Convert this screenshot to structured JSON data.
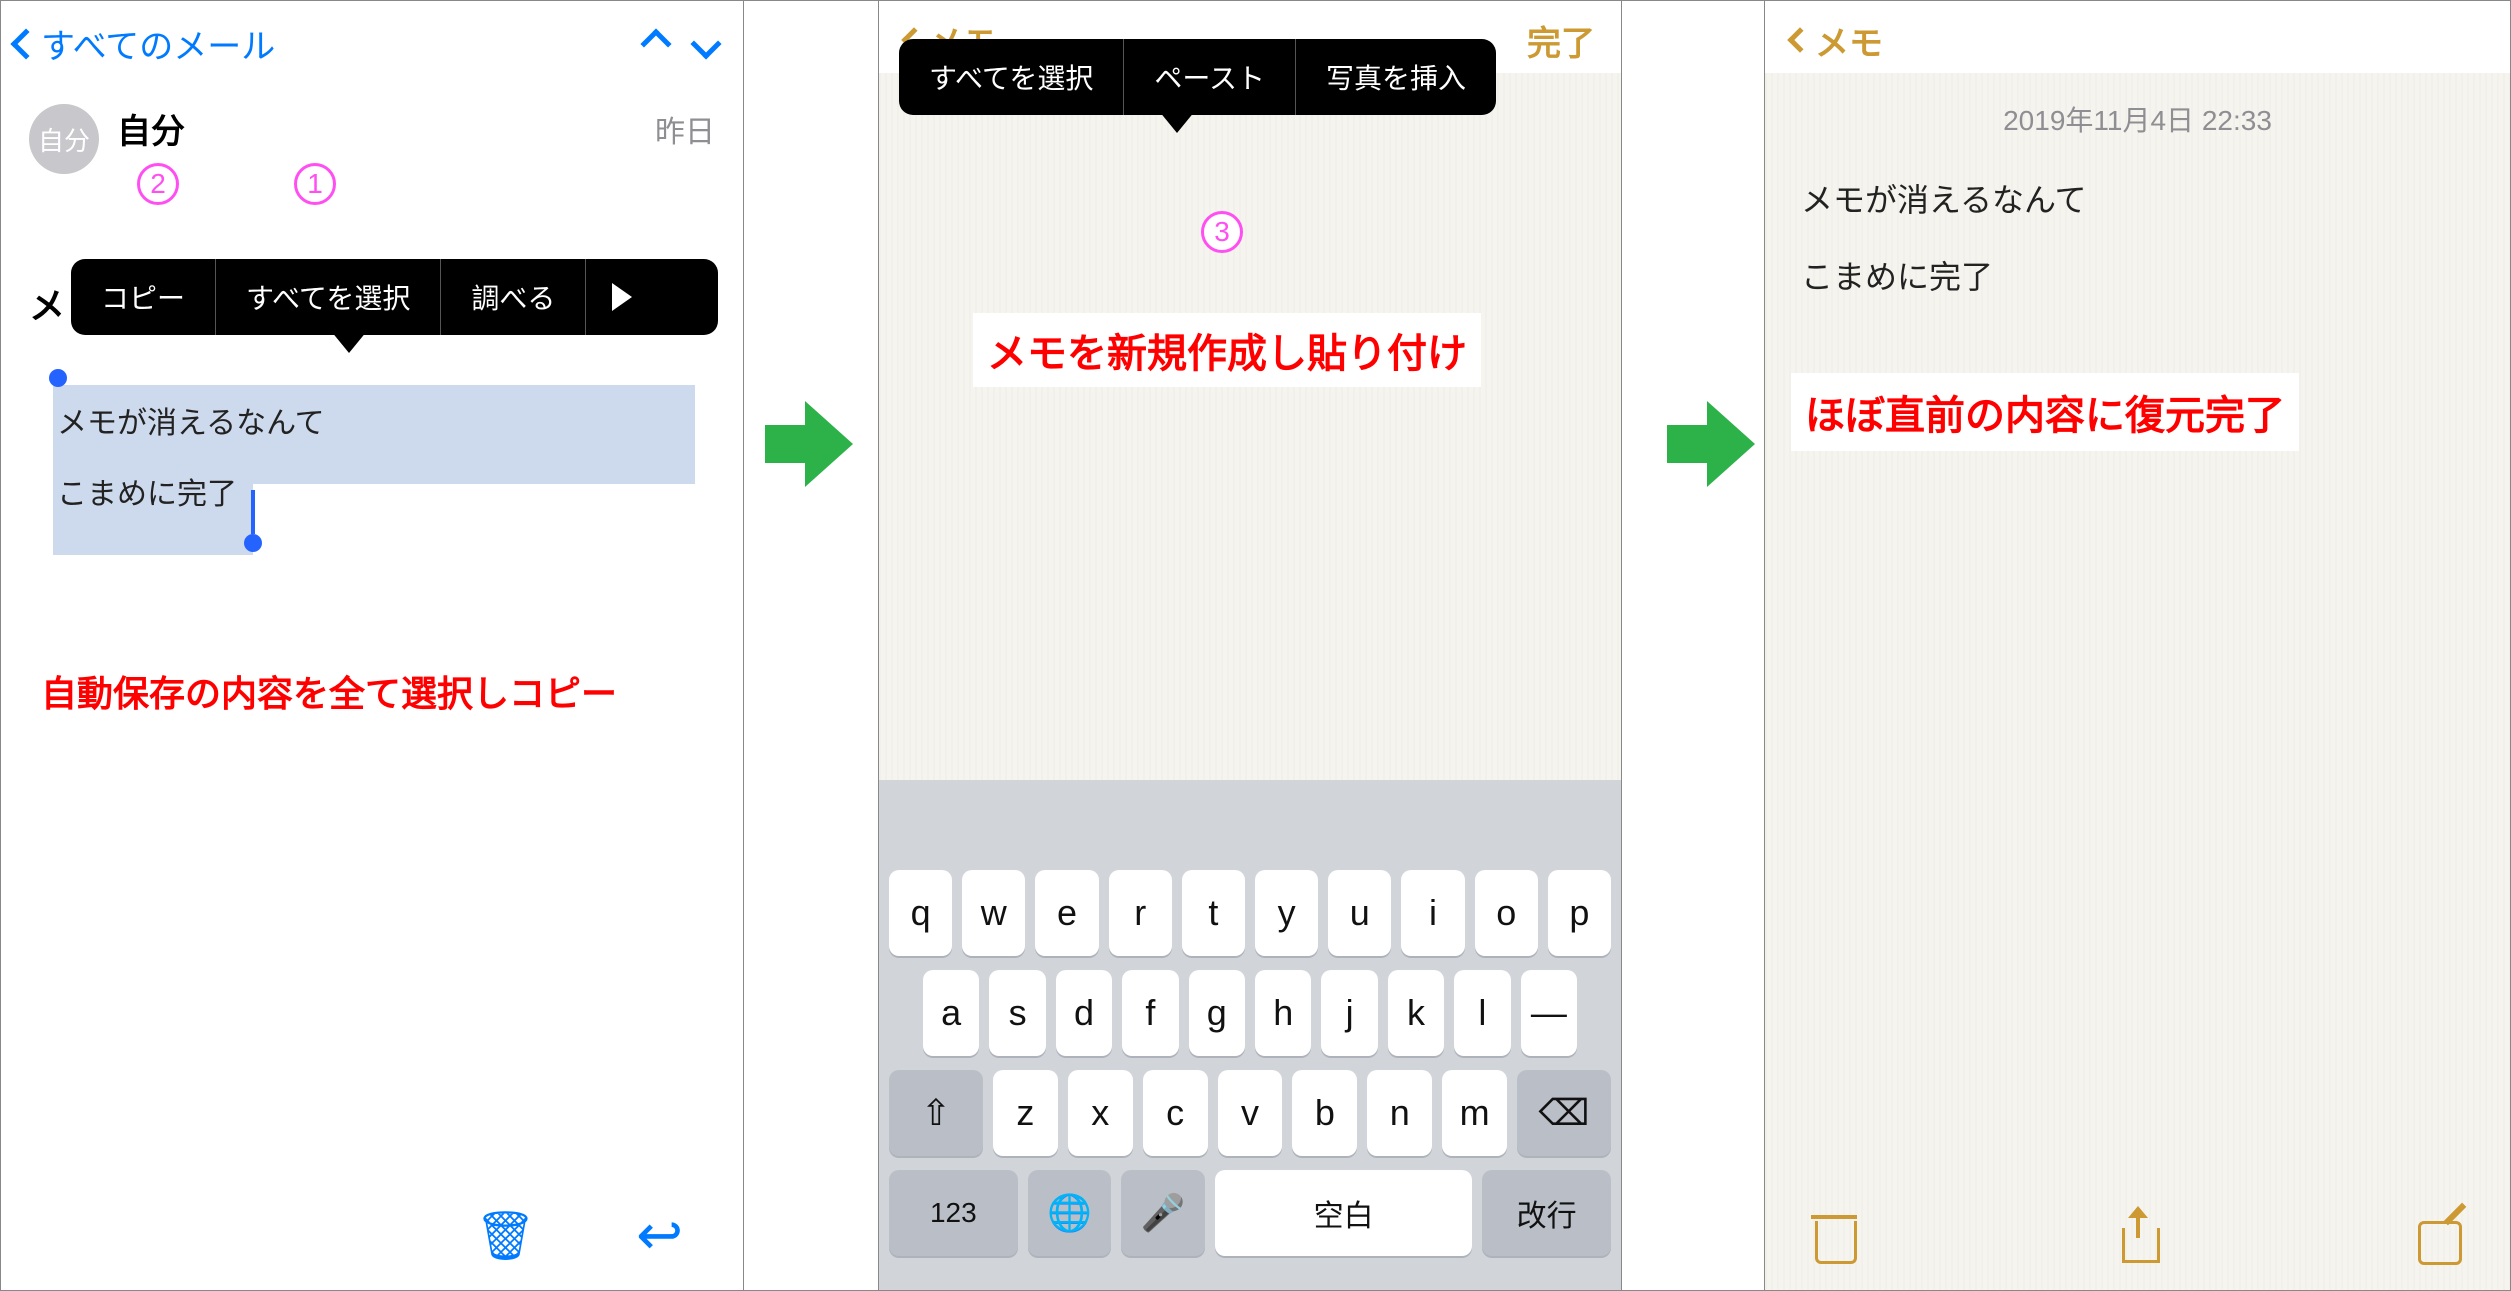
{
  "screen1": {
    "back_label": "すべてのメール",
    "avatar_text": "自分",
    "sender_name": "自分",
    "sender_date": "昨日",
    "circled_2": "2",
    "circled_1": "1",
    "subject_prefix": "メ",
    "context_menu": {
      "copy": "コピー",
      "select_all": "すべてを選択",
      "lookup": "調べる"
    },
    "body_line1": "メモが消えるなんて",
    "body_line2": "こまめに完了",
    "annotation": "自動保存の内容を全て選択しコピー"
  },
  "screen2": {
    "back_label": "メモ",
    "done_label": "完了",
    "context_menu": {
      "select_all": "すべてを選択",
      "paste": "ペースト",
      "insert_photo": "写真を挿入"
    },
    "circled_3": "3",
    "annotation": "メモを新規作成し貼り付け",
    "keyboard": {
      "row1": [
        "q",
        "w",
        "e",
        "r",
        "t",
        "y",
        "u",
        "i",
        "o",
        "p"
      ],
      "row2": [
        "a",
        "s",
        "d",
        "f",
        "g",
        "h",
        "j",
        "k",
        "l",
        "—"
      ],
      "row3_letters": [
        "z",
        "x",
        "c",
        "v",
        "b",
        "n",
        "m"
      ],
      "key_123": "123",
      "key_space": "空白",
      "key_return": "改行"
    }
  },
  "screen3": {
    "back_label": "メモ",
    "timestamp": "2019年11月4日 22:33",
    "body_line1": "メモが消えるなんて",
    "body_line2": "こまめに完了",
    "annotation": "ほぼ直前の内容に復元完了"
  }
}
